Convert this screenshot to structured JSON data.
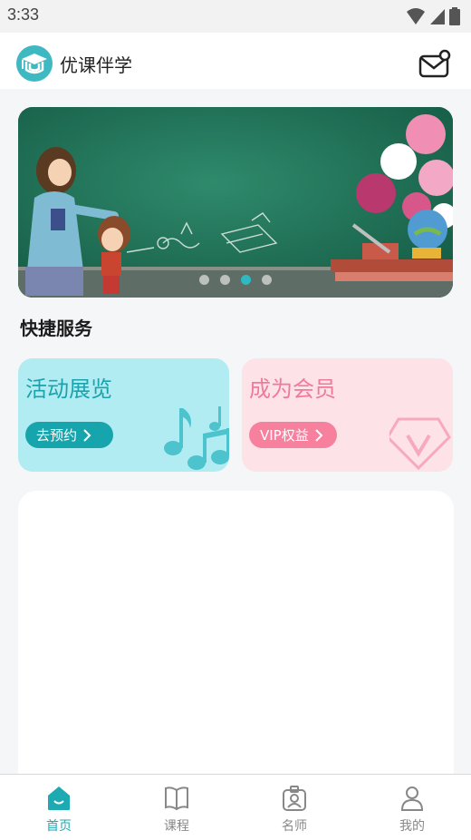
{
  "status_bar": {
    "time": "3:33"
  },
  "app": {
    "title": "优课伴学"
  },
  "banner": {
    "total_slides": 4,
    "active_slide": 3
  },
  "quick_services": {
    "title": "快捷服务",
    "cards": [
      {
        "title": "活动展览",
        "button": "去预约",
        "icon": "music-note-icon",
        "color": "#1aa3ad"
      },
      {
        "title": "成为会员",
        "button": "VIP权益",
        "icon": "vip-diamond-icon",
        "color": "#f07a9a"
      }
    ]
  },
  "tabs": [
    {
      "label": "首页",
      "icon": "home-icon",
      "active": true
    },
    {
      "label": "课程",
      "icon": "book-icon",
      "active": false
    },
    {
      "label": "名师",
      "icon": "teacher-badge-icon",
      "active": false
    },
    {
      "label": "我的",
      "icon": "user-icon",
      "active": false
    }
  ],
  "colors": {
    "accent": "#1eaab3",
    "member": "#f7809f"
  }
}
